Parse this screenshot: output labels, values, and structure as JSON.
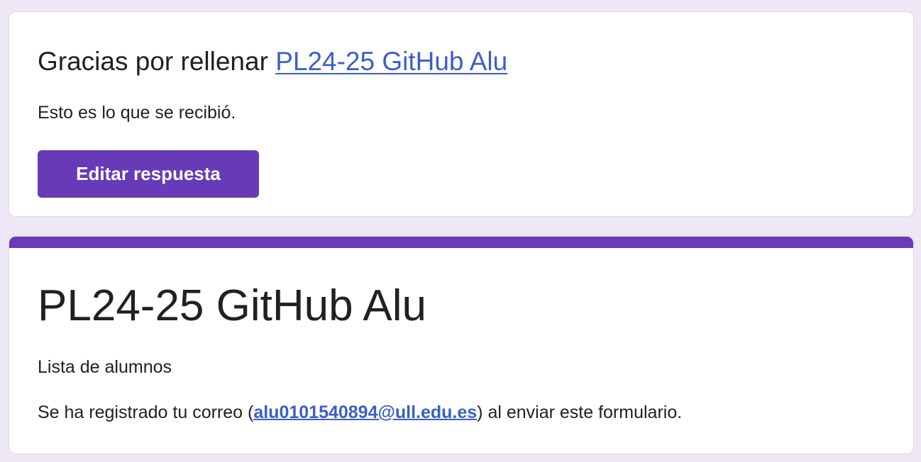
{
  "colors": {
    "page_background": "#ede7f6",
    "card_background": "#ffffff",
    "accent": "#673ab7",
    "link": "#3c5fc4",
    "text": "#202124"
  },
  "confirmation": {
    "thanks_prefix": "Gracias por rellenar ",
    "form_link_text": "PL24-25 GitHub Alu",
    "received_text": "Esto es lo que se recibió.",
    "edit_button_label": "Editar respuesta"
  },
  "form": {
    "title": "PL24-25 GitHub Alu",
    "description": "Lista de alumnos",
    "email_prefix": "Se ha registrado tu correo (",
    "email": "alu0101540894@ull.edu.es",
    "email_suffix": ") al enviar este formulario."
  }
}
